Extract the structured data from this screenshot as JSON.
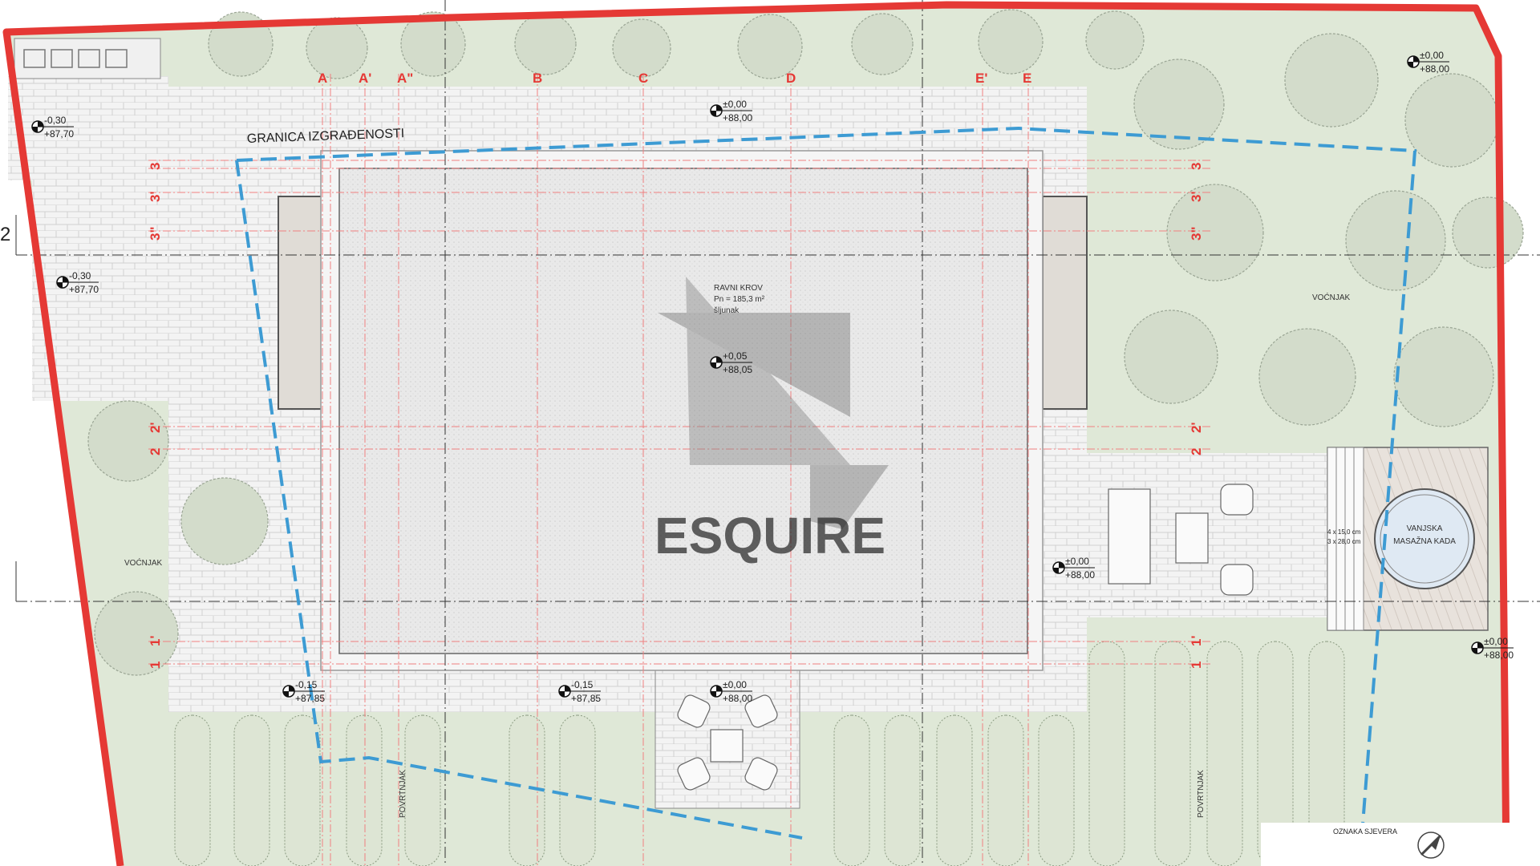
{
  "plan": {
    "boundary_label": "GRANICA IZGRAĐENOSTI",
    "roof": {
      "title": "RAVNI KROV",
      "area": "Pn = 185,3 m²",
      "material": "šljunak"
    },
    "grid_columns": [
      "A",
      "A'",
      "A\"",
      "B",
      "C",
      "D",
      "E'",
      "E"
    ],
    "grid_rows_left": [
      {
        "label": "3"
      },
      {
        "label": "3'"
      },
      {
        "label": "3\""
      },
      {
        "label": "2"
      },
      {
        "label": "1"
      },
      {
        "label": "1'"
      }
    ],
    "grid_rows_right": [
      {
        "label": "3"
      },
      {
        "label": "3'"
      },
      {
        "label": "3\""
      },
      {
        "label": "2"
      },
      {
        "label": "2'"
      },
      {
        "label": "1"
      },
      {
        "label": "1'"
      }
    ],
    "left_row_pair": [
      "2",
      "2'"
    ],
    "edge_mark": "2",
    "elevations": [
      {
        "top": "-0,30",
        "bottom": "+87,70"
      },
      {
        "top": "-0,30",
        "bottom": "+87,70"
      },
      {
        "top": "±0,00",
        "bottom": "+88,00"
      },
      {
        "top": "±0,00",
        "bottom": "+88,00"
      },
      {
        "top": "+0,05",
        "bottom": "+88,05"
      },
      {
        "top": "±0,00",
        "bottom": "+88,00"
      },
      {
        "top": "±0,00",
        "bottom": "+88,00"
      },
      {
        "top": "-0,15",
        "bottom": "+87,85"
      },
      {
        "top": "-0,15",
        "bottom": "+87,85"
      },
      {
        "top": "±0,00",
        "bottom": "+88,00"
      }
    ],
    "zones": {
      "orchard_right": "VOĆNJAK",
      "orchard_left": "VOĆNJAK",
      "vegetable_1": "POVRTNJAK",
      "vegetable_2": "POVRTNJAK"
    },
    "hot_tub": {
      "line1": "VANJSKA",
      "line2": "MASAŽNA KADA"
    },
    "steps": {
      "line1": "4 x 15,0 cm",
      "line2": "3 x 28,0 cm"
    },
    "north_label": "OZNAKA SJEVERA",
    "watermark": "ESQUIRE"
  },
  "colors": {
    "lawn": "#dfe8d7",
    "paving": "#f1f1f1",
    "roof": "#e6e6e6",
    "red_border": "#e53935",
    "blue_boundary": "#3d9bd3",
    "gridline": "#f08080"
  }
}
